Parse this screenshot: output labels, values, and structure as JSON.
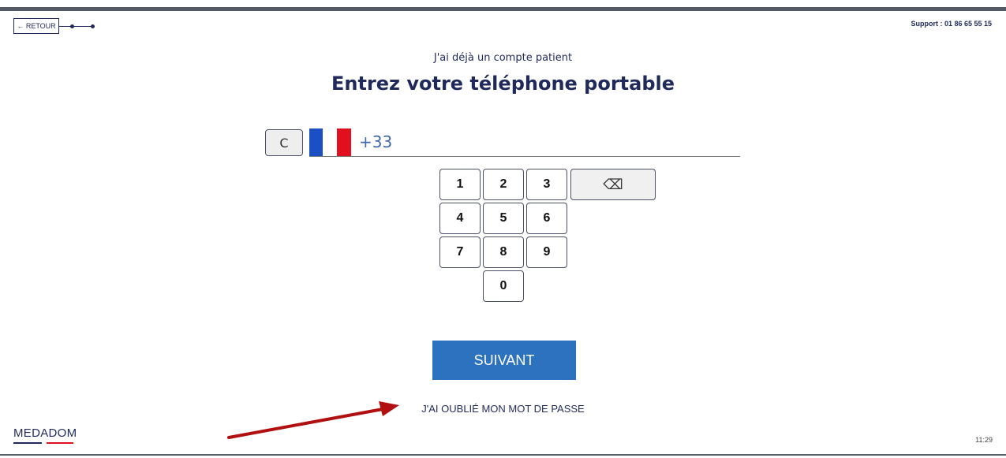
{
  "header": {
    "back_label": "← RETOUR",
    "support_text": "Support : 01 86 65 55 15"
  },
  "main": {
    "subtitle": "J'ai déjà un compte patient",
    "title": "Entrez votre téléphone portable",
    "phone": {
      "country_code": "+33",
      "reset_icon": "C",
      "flag": "france-flag-icon"
    },
    "keypad": {
      "keys": [
        "1",
        "2",
        "3",
        "4",
        "5",
        "6",
        "7",
        "8",
        "9",
        "0"
      ],
      "backspace_icon": "⌫"
    },
    "next_label": "SUIVANT",
    "forgot_label": "J'AI OUBLIÉ MON MOT DE PASSE"
  },
  "footer": {
    "logo": "MEDADOM",
    "time": "11:29"
  },
  "colors": {
    "navy": "#1f2a5a",
    "primary": "#2d72bf",
    "flag_blue": "#1a50c4",
    "flag_red": "#e0101e",
    "annotation_arrow": "#b01010"
  }
}
